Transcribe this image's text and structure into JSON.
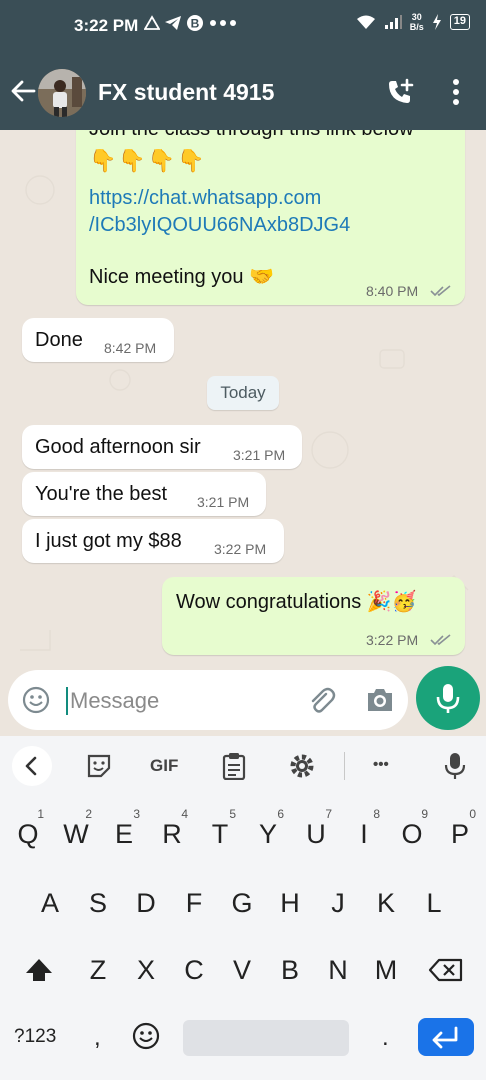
{
  "status_bar": {
    "time": "3:22 PM",
    "net_speed_value": "30",
    "net_speed_unit": "B/s",
    "battery": "19"
  },
  "header": {
    "contact_name": "FX student 4915"
  },
  "messages": [
    {
      "direction": "outgoing",
      "line1": "Join the class through this link below",
      "emoji_line": "👇👇👇👇",
      "link_line1": "https://chat.whatsapp.com",
      "link_line2": "/ICb3lyIQOUU66NAxb8DJG4",
      "closing": "Nice meeting you 🤝",
      "time": "8:40 PM"
    },
    {
      "direction": "incoming",
      "text": "Done",
      "time": "8:42 PM"
    },
    {
      "direction": "incoming",
      "text": "Good afternoon sir",
      "time": "3:21 PM"
    },
    {
      "direction": "incoming",
      "text": "You're the best",
      "time": "3:21 PM"
    },
    {
      "direction": "incoming",
      "text": "I just got my $88",
      "time": "3:22 PM"
    },
    {
      "direction": "outgoing",
      "text": "Wow congratulations 🎉🥳",
      "time": "3:22 PM"
    }
  ],
  "date_divider": "Today",
  "composer": {
    "placeholder": "Message"
  },
  "keyboard": {
    "toolbar_gif": "GIF",
    "toolbar_more": "•••",
    "row1": [
      {
        "k": "Q",
        "h": "1"
      },
      {
        "k": "W",
        "h": "2"
      },
      {
        "k": "E",
        "h": "3"
      },
      {
        "k": "R",
        "h": "4"
      },
      {
        "k": "T",
        "h": "5"
      },
      {
        "k": "Y",
        "h": "6"
      },
      {
        "k": "U",
        "h": "7"
      },
      {
        "k": "I",
        "h": "8"
      },
      {
        "k": "O",
        "h": "9"
      },
      {
        "k": "P",
        "h": "0"
      }
    ],
    "row2": [
      "A",
      "S",
      "D",
      "F",
      "G",
      "H",
      "J",
      "K",
      "L"
    ],
    "row3": [
      "Z",
      "X",
      "C",
      "V",
      "B",
      "N",
      "M"
    ],
    "symbols_key": "?123",
    "comma_key": ",",
    "period_key": "."
  },
  "colors": {
    "header_bg": "#3a4e56",
    "chat_bg": "#ece5dd",
    "outgoing_bubble": "#e7fccf",
    "link": "#1e7ab8",
    "accent_green": "#1aa37a",
    "enter_key_blue": "#1a73e8"
  }
}
